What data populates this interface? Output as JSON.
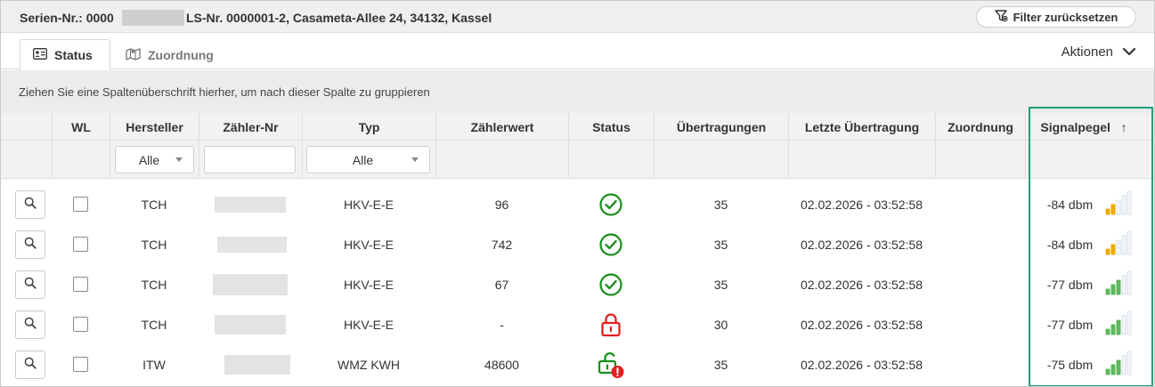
{
  "header": {
    "title_prefix": "Serien-Nr.: 0000",
    "title_suffix": "LS-Nr. 0000001-2, Casameta-Allee 24, 34132, Kassel",
    "filter_reset_label": "Filter zurücksetzen"
  },
  "tabs": {
    "status_label": "Status",
    "zuordnung_label": "Zuordnung",
    "actions_label": "Aktionen"
  },
  "group_hint": "Ziehen Sie eine Spaltenüberschrift hierher, um nach dieser Spalte zu gruppieren",
  "columns": {
    "wl": "WL",
    "hersteller": "Hersteller",
    "zaehler_nr": "Zähler-Nr",
    "typ": "Typ",
    "zaehlerwert": "Zählerwert",
    "status": "Status",
    "uebertragungen": "Übertragungen",
    "letzte": "Letzte Übertragung",
    "zuordnung": "Zuordnung",
    "signalpegel": "Signalpegel",
    "sort_indicator": "↑"
  },
  "filters": {
    "hersteller_value": "Alle",
    "typ_value": "Alle",
    "zaehler_nr_value": ""
  },
  "colors": {
    "ok_green": "#1a8f1a",
    "locked_red": "#e02020",
    "bar_orange": "#f0a800",
    "bar_green": "#5cb85c",
    "bar_empty": "#d7dfe8",
    "highlight": "#1f9e7e"
  },
  "rows": [
    {
      "hersteller": "TCH",
      "typ": "HKV-E-E",
      "zaehlerwert": "96",
      "status_icon": "check-circle-icon",
      "uebertragungen": "35",
      "letzte": "02.02.2026 - 03:52:58",
      "zuordnung": "",
      "signal": "-84 dbm",
      "signal_bars": 2,
      "signal_color": "orange"
    },
    {
      "hersteller": "TCH",
      "typ": "HKV-E-E",
      "zaehlerwert": "742",
      "status_icon": "check-circle-icon",
      "uebertragungen": "35",
      "letzte": "02.02.2026 - 03:52:58",
      "zuordnung": "",
      "signal": "-84 dbm",
      "signal_bars": 2,
      "signal_color": "orange"
    },
    {
      "hersteller": "TCH",
      "typ": "HKV-E-E",
      "zaehlerwert": "67",
      "status_icon": "check-circle-icon",
      "uebertragungen": "35",
      "letzte": "02.02.2026 - 03:52:58",
      "zuordnung": "",
      "signal": "-77 dbm",
      "signal_bars": 3,
      "signal_color": "green"
    },
    {
      "hersteller": "TCH",
      "typ": "HKV-E-E",
      "zaehlerwert": "-",
      "status_icon": "lock-closed-icon",
      "uebertragungen": "30",
      "letzte": "02.02.2026 - 03:52:58",
      "zuordnung": "",
      "signal": "-77 dbm",
      "signal_bars": 3,
      "signal_color": "green"
    },
    {
      "hersteller": "ITW",
      "typ": "WMZ KWH",
      "zaehlerwert": "48600",
      "status_icon": "lock-open-warning-icon",
      "uebertragungen": "35",
      "letzte": "02.02.2026 - 03:52:58",
      "zuordnung": "",
      "signal": "-75 dbm",
      "signal_bars": 3,
      "signal_color": "green"
    }
  ]
}
